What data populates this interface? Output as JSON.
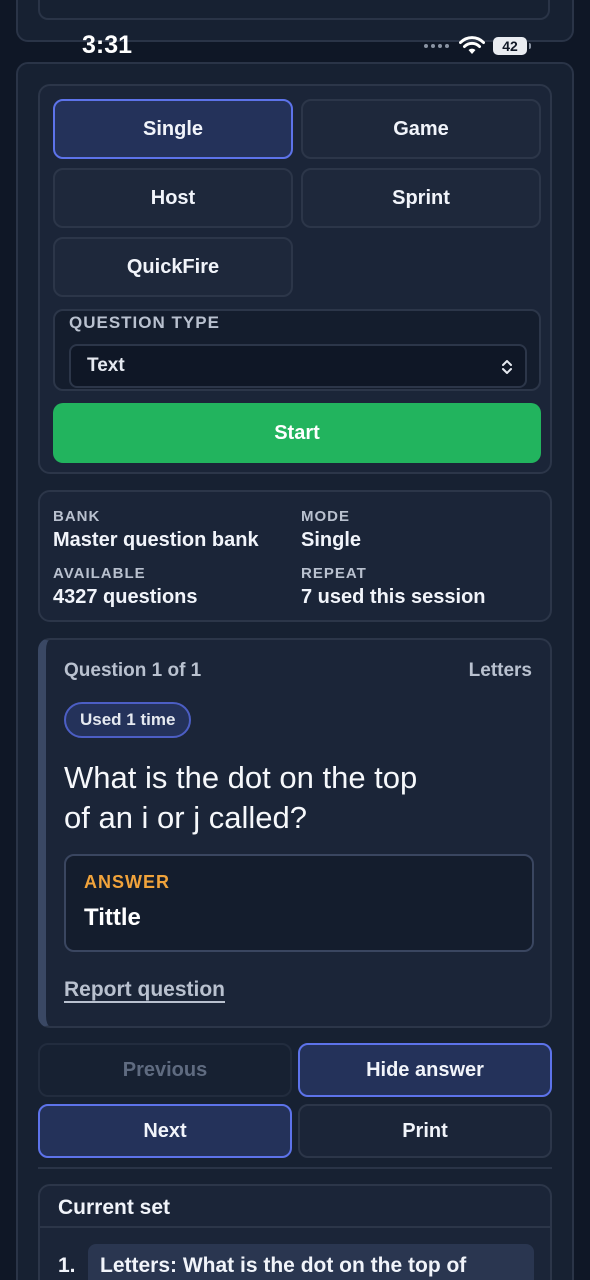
{
  "status_bar": {
    "time": "3:31",
    "battery": "42"
  },
  "modes": [
    {
      "label": "Single",
      "active": true
    },
    {
      "label": "Game",
      "active": false
    },
    {
      "label": "Host",
      "active": false
    },
    {
      "label": "Sprint",
      "active": false
    },
    {
      "label": "QuickFire",
      "active": false
    }
  ],
  "question_type": {
    "label": "QUESTION TYPE",
    "selected": "Text"
  },
  "start_label": "Start",
  "info": {
    "bank_label": "BANK",
    "bank_value": "Master question bank",
    "mode_label": "MODE",
    "mode_value": "Single",
    "available_label": "AVAILABLE",
    "available_value": "4327 questions",
    "repeat_label": "REPEAT",
    "repeat_value": "7 used this session"
  },
  "question": {
    "progress": "Question 1 of 1",
    "category": "Letters",
    "used_badge": "Used 1 time",
    "text": "What is the dot on the top of an i or j called?",
    "answer_label": "ANSWER",
    "answer_value": "Tittle",
    "report_label": "Report question"
  },
  "nav": {
    "previous": "Previous",
    "hide_answer": "Hide answer",
    "next": "Next",
    "print": "Print"
  },
  "current_set": {
    "title": "Current set",
    "items": [
      {
        "number": "1.",
        "text": "Letters: What is the dot on the top of"
      }
    ]
  },
  "colors": {
    "accent": "#5d73ea",
    "start": "#22b45e",
    "answer_label": "#f1a33b",
    "background": "#0f1726"
  }
}
